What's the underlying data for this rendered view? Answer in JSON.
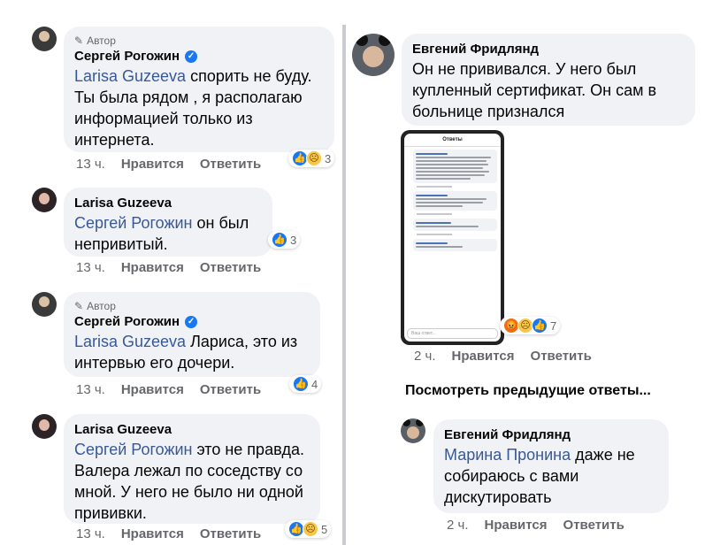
{
  "author_badge": "Автор",
  "like_label": "Нравится",
  "reply_label": "Ответить",
  "left": [
    {
      "name": "Сергей Рогожин",
      "mention": "Larisa Guzeeva",
      "text": "спорить не буду. Ты была рядом , я располагаю информацией только из интернета.",
      "time": "13 ч.",
      "reactions": "3"
    },
    {
      "name": "Larisa Guzeeva",
      "mention": "Сергей Рогожин",
      "text": "он был непривитый.",
      "time": "13 ч.",
      "reactions": "3"
    },
    {
      "name": "Сергей Рогожин",
      "mention": "Larisa Guzeeva",
      "text": "Лариса, это из интервью его дочери.",
      "time": "13 ч.",
      "reactions": "4"
    },
    {
      "name": "Larisa Guzeeva",
      "mention": "Сергей Рогожин",
      "text": "это не правда. Валера лежал по соседству со мной. У него не было ни одной прививки.",
      "time": "13 ч.",
      "reactions": "5"
    }
  ],
  "right": {
    "top": {
      "name": "Евгений Фридлянд",
      "text": "Он не прививался. У него был купленный сертификат. Он сам в больнице признался",
      "time": "2 ч.",
      "reactions": "7"
    },
    "screenshot_title": "Ответы",
    "screenshot_input": "Ваш ответ...",
    "more_replies": "Посмотреть предыдущие ответы...",
    "bottom": {
      "name": "Евгений Фридлянд",
      "mention": "Марина Пронина",
      "text": "даже не собираюсь с вами дискутировать",
      "time": "2 ч."
    }
  }
}
